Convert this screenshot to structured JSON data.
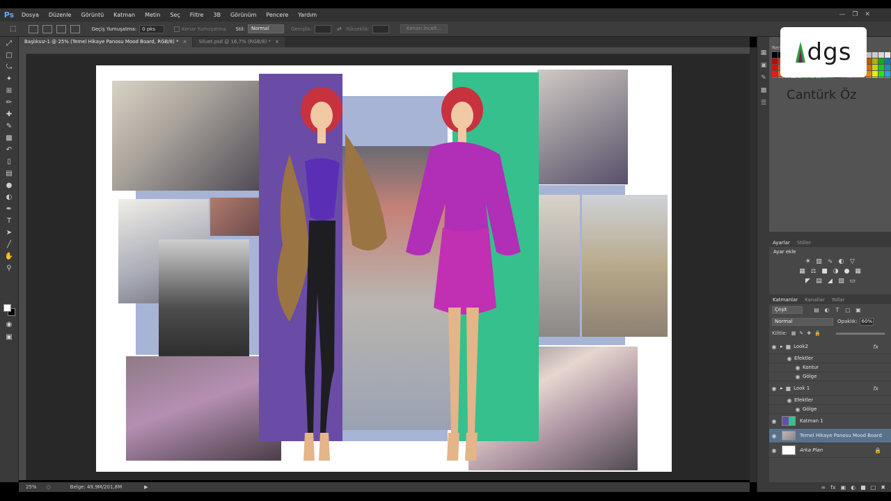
{
  "app": {
    "logo": "Ps"
  },
  "menu": [
    "Dosya",
    "Düzenle",
    "Görüntü",
    "Katman",
    "Metin",
    "Seç",
    "Filtre",
    "3B",
    "Görünüm",
    "Pencere",
    "Yardım"
  ],
  "options": {
    "feather_label": "Geçiş Yumuşatma:",
    "feather_value": "0 pks",
    "antialias_label": "Kenar Yumuşatma",
    "style_label": "Stil:",
    "style_value": "Normal",
    "width_label": "Genişlik:",
    "height_label": "Yükseklik:",
    "refine_button": "Kenarı İncelt..."
  },
  "tabs": [
    {
      "label": "Başlıksız-1 @ 25% (Temel Hikaye Panosu Mood Board, RGB/8) *",
      "active": true
    },
    {
      "label": "Siluet.psd @ 16,7% (RGB/8) *",
      "active": false
    }
  ],
  "status": {
    "zoom": "25%",
    "doc_info": "Belge: 49,9M/201,8M"
  },
  "watermark": {
    "logo": "dgs",
    "presenter": "Cantürk Öz"
  },
  "swatches_panel": {
    "tab": "Renk"
  },
  "adjustments": {
    "tabs": [
      "Ayarlar",
      "Stiller"
    ],
    "title": "Ayar ekle"
  },
  "layers_panel": {
    "tabs": [
      "Katmanlar",
      "Kanallar",
      "Yollar"
    ],
    "filter": "Çeşit",
    "blend_mode": "Normal",
    "opacity_label": "Opaklık:",
    "opacity_value": "60%",
    "lock_label": "Kilitle:",
    "layers": [
      {
        "name": "Look2",
        "type": "group",
        "fx": true
      },
      {
        "name": "Efektler",
        "type": "effects"
      },
      {
        "name": "Kontur",
        "type": "effect"
      },
      {
        "name": "Gölge",
        "type": "effect"
      },
      {
        "name": "Look 1",
        "type": "group",
        "fx": true
      },
      {
        "name": "Efektler",
        "type": "effects"
      },
      {
        "name": "Gölge",
        "type": "effect"
      },
      {
        "name": "Katman 1",
        "type": "layer"
      },
      {
        "name": "Temel Hikaye Panosu Mood Board",
        "type": "layer",
        "selected": true
      },
      {
        "name": "Arka Plan",
        "type": "background",
        "locked": true
      }
    ]
  },
  "colors": {
    "purple_panel": "#6a4ca6",
    "green_panel": "#35c08e",
    "blue_panel": "#a7b4d6",
    "selected_layer": "#59718b"
  }
}
